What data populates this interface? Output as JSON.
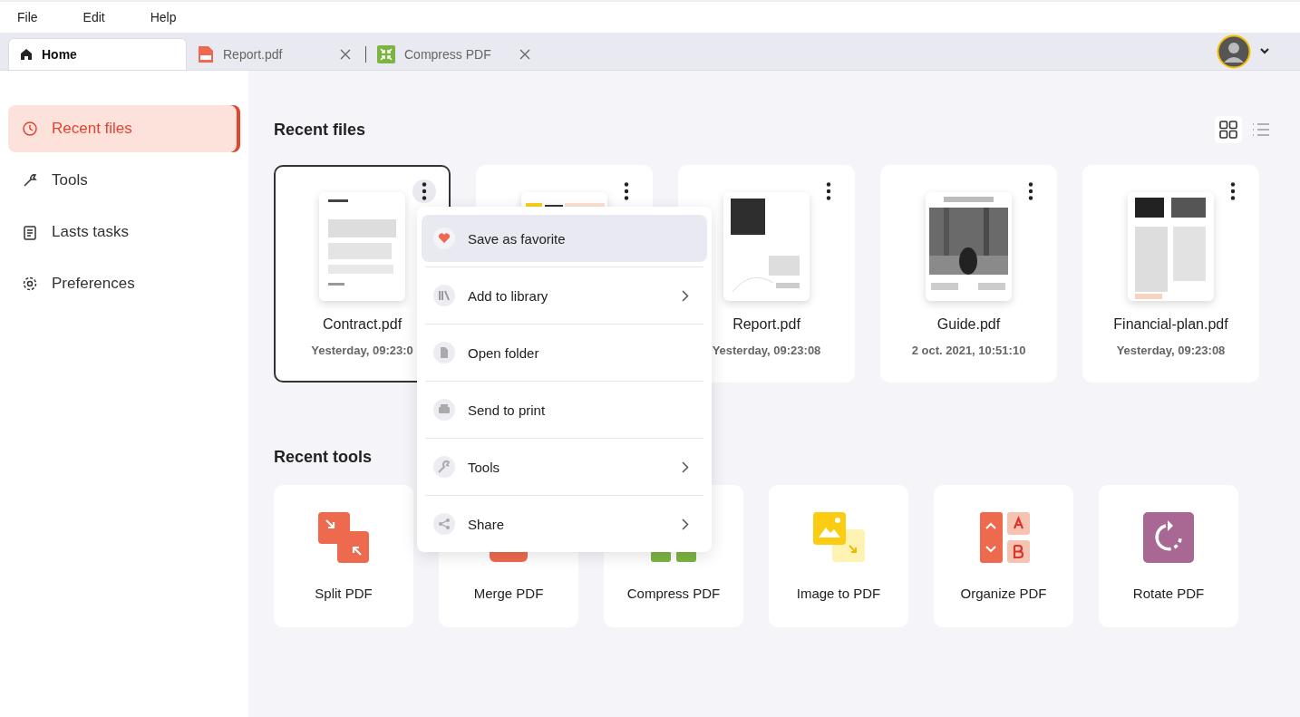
{
  "menu_bar": [
    "File",
    "Edit",
    "Help"
  ],
  "tabs": [
    {
      "label": "Home",
      "selected": true,
      "closable": false
    },
    {
      "label": "Report.pdf",
      "selected": false,
      "closable": true
    },
    {
      "label": "Compress PDF",
      "selected": false,
      "closable": true
    }
  ],
  "sidebar": {
    "items": [
      {
        "label": "Recent files",
        "selected": true
      },
      {
        "label": "Tools",
        "selected": false
      },
      {
        "label": "Lasts tasks",
        "selected": false
      },
      {
        "label": "Preferences",
        "selected": false
      }
    ]
  },
  "recent_files": {
    "title": "Recent files",
    "view_modes": [
      {
        "kind": "grid",
        "selected": true
      },
      {
        "kind": "list",
        "selected": false
      }
    ],
    "files": [
      {
        "name": "Contract.pdf",
        "date": "Yesterday, 09:23:0",
        "selected": true
      },
      {
        "selected": false
      },
      {
        "name": "Report.pdf",
        "date": "Yesterday, 09:23:08",
        "selected": false
      },
      {
        "name": "Guide.pdf",
        "date": "2 oct. 2021, 10:51:10",
        "selected": false
      },
      {
        "name": "Financial-plan.pdf",
        "date": "Yesterday, 09:23:08",
        "selected": false
      }
    ]
  },
  "recent_tools": {
    "title": "Recent tools",
    "tools": [
      {
        "label": "Split PDF"
      },
      {
        "label": "Merge PDF"
      },
      {
        "label": "Compress PDF"
      },
      {
        "label": "Image to PDF"
      },
      {
        "label": "Organize PDF"
      },
      {
        "label": "Rotate PDF"
      }
    ]
  },
  "context_menu": {
    "items": [
      {
        "label": "Save as favorite",
        "highlighted": true,
        "submenu": false
      },
      {
        "label": "Add to library",
        "highlighted": false,
        "submenu": true
      },
      {
        "label": "Open folder",
        "highlighted": false,
        "submenu": false
      },
      {
        "label": "Send to print",
        "highlighted": false,
        "submenu": false
      },
      {
        "label": "Tools",
        "highlighted": false,
        "submenu": true
      },
      {
        "label": "Share",
        "highlighted": false,
        "submenu": true
      }
    ]
  }
}
